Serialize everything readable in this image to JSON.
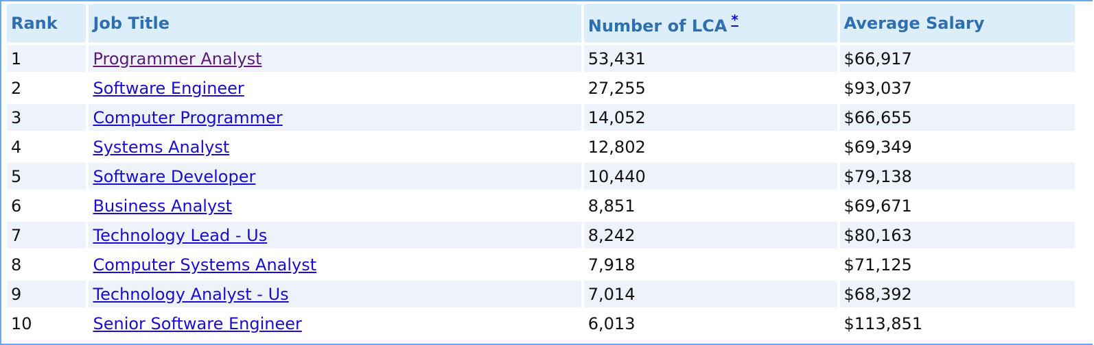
{
  "table": {
    "headers": {
      "rank": "Rank",
      "job_title": "Job Title",
      "num_lca": "Number of LCA",
      "num_lca_footnote": "*",
      "avg_salary": "Average Salary"
    },
    "rows": [
      {
        "rank": "1",
        "title": "Programmer Analyst",
        "lca": "53,431",
        "salary": "$66,917",
        "visited": true
      },
      {
        "rank": "2",
        "title": "Software Engineer",
        "lca": "27,255",
        "salary": "$93,037",
        "visited": false
      },
      {
        "rank": "3",
        "title": "Computer Programmer",
        "lca": "14,052",
        "salary": "$66,655",
        "visited": false
      },
      {
        "rank": "4",
        "title": "Systems Analyst",
        "lca": "12,802",
        "salary": "$69,349",
        "visited": false
      },
      {
        "rank": "5",
        "title": "Software Developer",
        "lca": "10,440",
        "salary": "$79,138",
        "visited": false
      },
      {
        "rank": "6",
        "title": "Business Analyst",
        "lca": "8,851",
        "salary": "$69,671",
        "visited": false
      },
      {
        "rank": "7",
        "title": "Technology Lead - Us",
        "lca": "8,242",
        "salary": "$80,163",
        "visited": false
      },
      {
        "rank": "8",
        "title": "Computer Systems Analyst",
        "lca": "7,918",
        "salary": "$71,125",
        "visited": false
      },
      {
        "rank": "9",
        "title": "Technology Analyst - Us",
        "lca": "7,014",
        "salary": "$68,392",
        "visited": false
      },
      {
        "rank": "10",
        "title": "Senior Software Engineer",
        "lca": "6,013",
        "salary": "$113,851",
        "visited": false
      }
    ]
  },
  "colors": {
    "header_bg": "#ddeefb",
    "header_text": "#2f6fb0",
    "odd_row_bg": "#eef3fb",
    "even_row_bg": "#ffffff",
    "link": "#1a0dd0",
    "visited_link": "#5a1a7a",
    "border": "#6aa7f0"
  }
}
